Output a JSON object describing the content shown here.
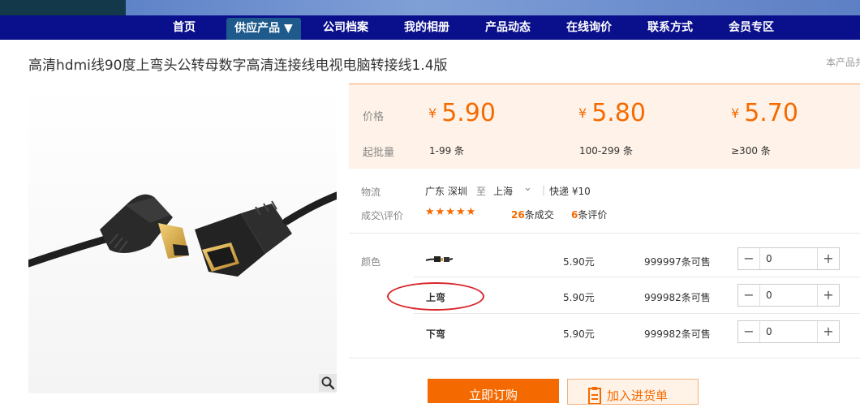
{
  "nav": {
    "items": [
      "首页",
      "供应产品 ▼",
      "公司档案",
      "我的相册",
      "产品动态",
      "在线询价",
      "联系方式",
      "会员专区"
    ]
  },
  "product": {
    "title": "高清hdmi线90度上弯头公转母数字高清连接线电视电脑转接线1.4版",
    "side_note": "本产品共"
  },
  "pricing": {
    "price_label": "价格",
    "batch_label": "起批量",
    "currency": "¥",
    "tiers": [
      {
        "price": "5.90",
        "batch": "1-99 条"
      },
      {
        "price": "5.80",
        "batch": "100-299 条"
      },
      {
        "price": "5.70",
        "batch": "≥300 条"
      }
    ]
  },
  "logistics": {
    "label": "物流",
    "from": "广东 深圳",
    "to_word": "至",
    "to": "上海",
    "express": "快递 ¥10"
  },
  "reviews": {
    "label": "成交\\评价",
    "stars": "★★★★★",
    "deals_count": "26",
    "deals_suffix": "条成交",
    "reviews_count": "6",
    "reviews_suffix": "条评价"
  },
  "variants": {
    "label": "颜色",
    "rows": [
      {
        "name": "",
        "price": "5.90元",
        "stock": "999997条可售",
        "qty": "0"
      },
      {
        "name": "上弯",
        "price": "5.90元",
        "stock": "999982条可售",
        "qty": "0"
      },
      {
        "name": "下弯",
        "price": "5.90元",
        "stock": "999982条可售",
        "qty": "0"
      }
    ],
    "minus": "−",
    "plus": "+"
  },
  "actions": {
    "buy_now": "立即订购",
    "add_to_list": "加入进货单"
  },
  "colors": {
    "accent": "#f56a00",
    "nav_bg": "#0a0f8c",
    "annotation": "#d9252a"
  }
}
